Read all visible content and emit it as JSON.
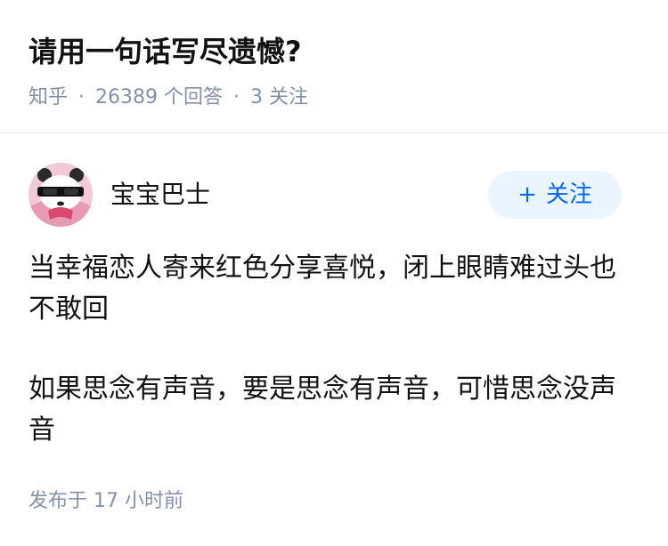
{
  "question": {
    "title": "请用一句话写尽遗憾?",
    "source": "知乎",
    "answer_count": "26389",
    "answer_label": "个回答",
    "follow_count": "3",
    "follow_label": "关注"
  },
  "answer": {
    "author_name": "宝宝巴士",
    "follow_button": {
      "icon": "plus-icon",
      "plus": "+",
      "label": "关注"
    },
    "paragraphs": [
      "当幸福恋人寄来红色分享喜悦，闭上眼睛难过头也不敢回",
      "如果思念有声音，要是思念有声音，可惜思念没声音"
    ],
    "published": "发布于 17 小时前"
  },
  "colors": {
    "text": "#121212",
    "meta": "#8590a6",
    "accent": "#0066ff",
    "follow_bg": "#ebf5ff"
  }
}
